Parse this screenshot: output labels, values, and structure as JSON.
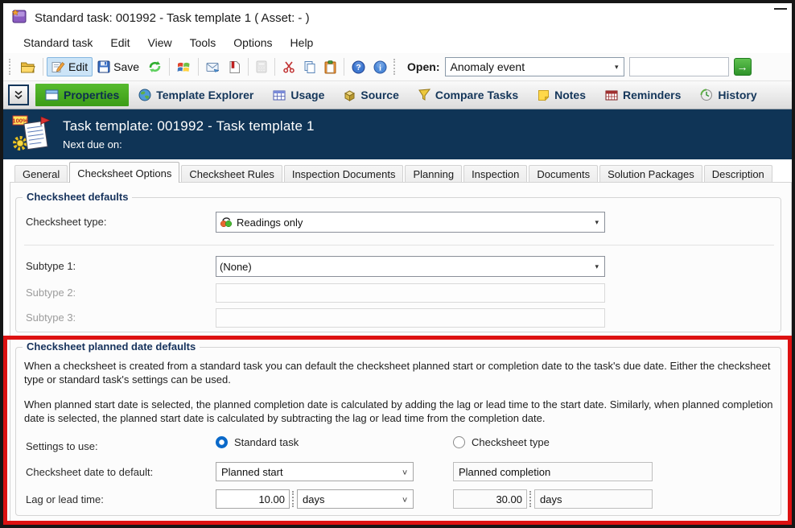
{
  "titlebar": {
    "title": "Standard task: 001992 - Task template 1   ( Asset:  -  )"
  },
  "menu": {
    "items": [
      "Standard task",
      "Edit",
      "View",
      "Tools",
      "Options",
      "Help"
    ]
  },
  "toolbar": {
    "edit": "Edit",
    "save": "Save",
    "open_label": "Open:",
    "open_value": "Anomaly event",
    "quick_value": ""
  },
  "icons": {
    "help": "?",
    "info": "i",
    "go_arrow": "→",
    "combo_arrow": "▾",
    "chevron_thin": "∨"
  },
  "nav": {
    "properties": "Properties",
    "template_explorer": "Template Explorer",
    "usage": "Usage",
    "source": "Source",
    "compare_tasks": "Compare Tasks",
    "notes": "Notes",
    "reminders": "Reminders",
    "history": "History"
  },
  "header": {
    "title": "Task template: 001992 - Task template 1",
    "subtitle": "Next due on:"
  },
  "tabs": {
    "items": [
      "General",
      "Checksheet Options",
      "Checksheet Rules",
      "Inspection Documents",
      "Planning",
      "Inspection",
      "Documents",
      "Solution Packages",
      "Description"
    ],
    "active": "Checksheet Options"
  },
  "defaults_group": {
    "title": "Checksheet defaults",
    "type_label": "Checksheet type:",
    "type_value": "Readings only",
    "subtype1_label": "Subtype 1:",
    "subtype1_value": "(None)",
    "subtype2_label": "Subtype 2:",
    "subtype2_value": "",
    "subtype3_label": "Subtype 3:",
    "subtype3_value": ""
  },
  "planned_group": {
    "title": "Checksheet planned date defaults",
    "para1": "When a checksheet is created from a standard task you can default the checksheet planned start or completion date to the task's due date.   Either the checksheet type or standard task's settings can be used.",
    "para2": "When planned start date is selected, the planned completion date is calculated by adding the lag or lead time to the start date.   Similarly, when planned completion date is selected, the planned start date is calculated by subtracting the lag or lead time from the completion date.",
    "settings_label": "Settings to use:",
    "radio_standard_task": "Standard task",
    "radio_checksheet_type": "Checksheet type",
    "date_label": "Checksheet date to default:",
    "date_value_left": "Planned start",
    "date_value_right": "Planned completion",
    "lag_label": "Lag or lead time:",
    "lag_value_left": "10.00",
    "lag_unit_left": "days",
    "lag_value_right": "30.00",
    "lag_unit_right": "days"
  },
  "colors": {
    "header_navy": "#0f3456",
    "active_green": "#3c9c16",
    "highlight_red": "#dd1111",
    "toolbar_selected": "#cce4f7"
  }
}
